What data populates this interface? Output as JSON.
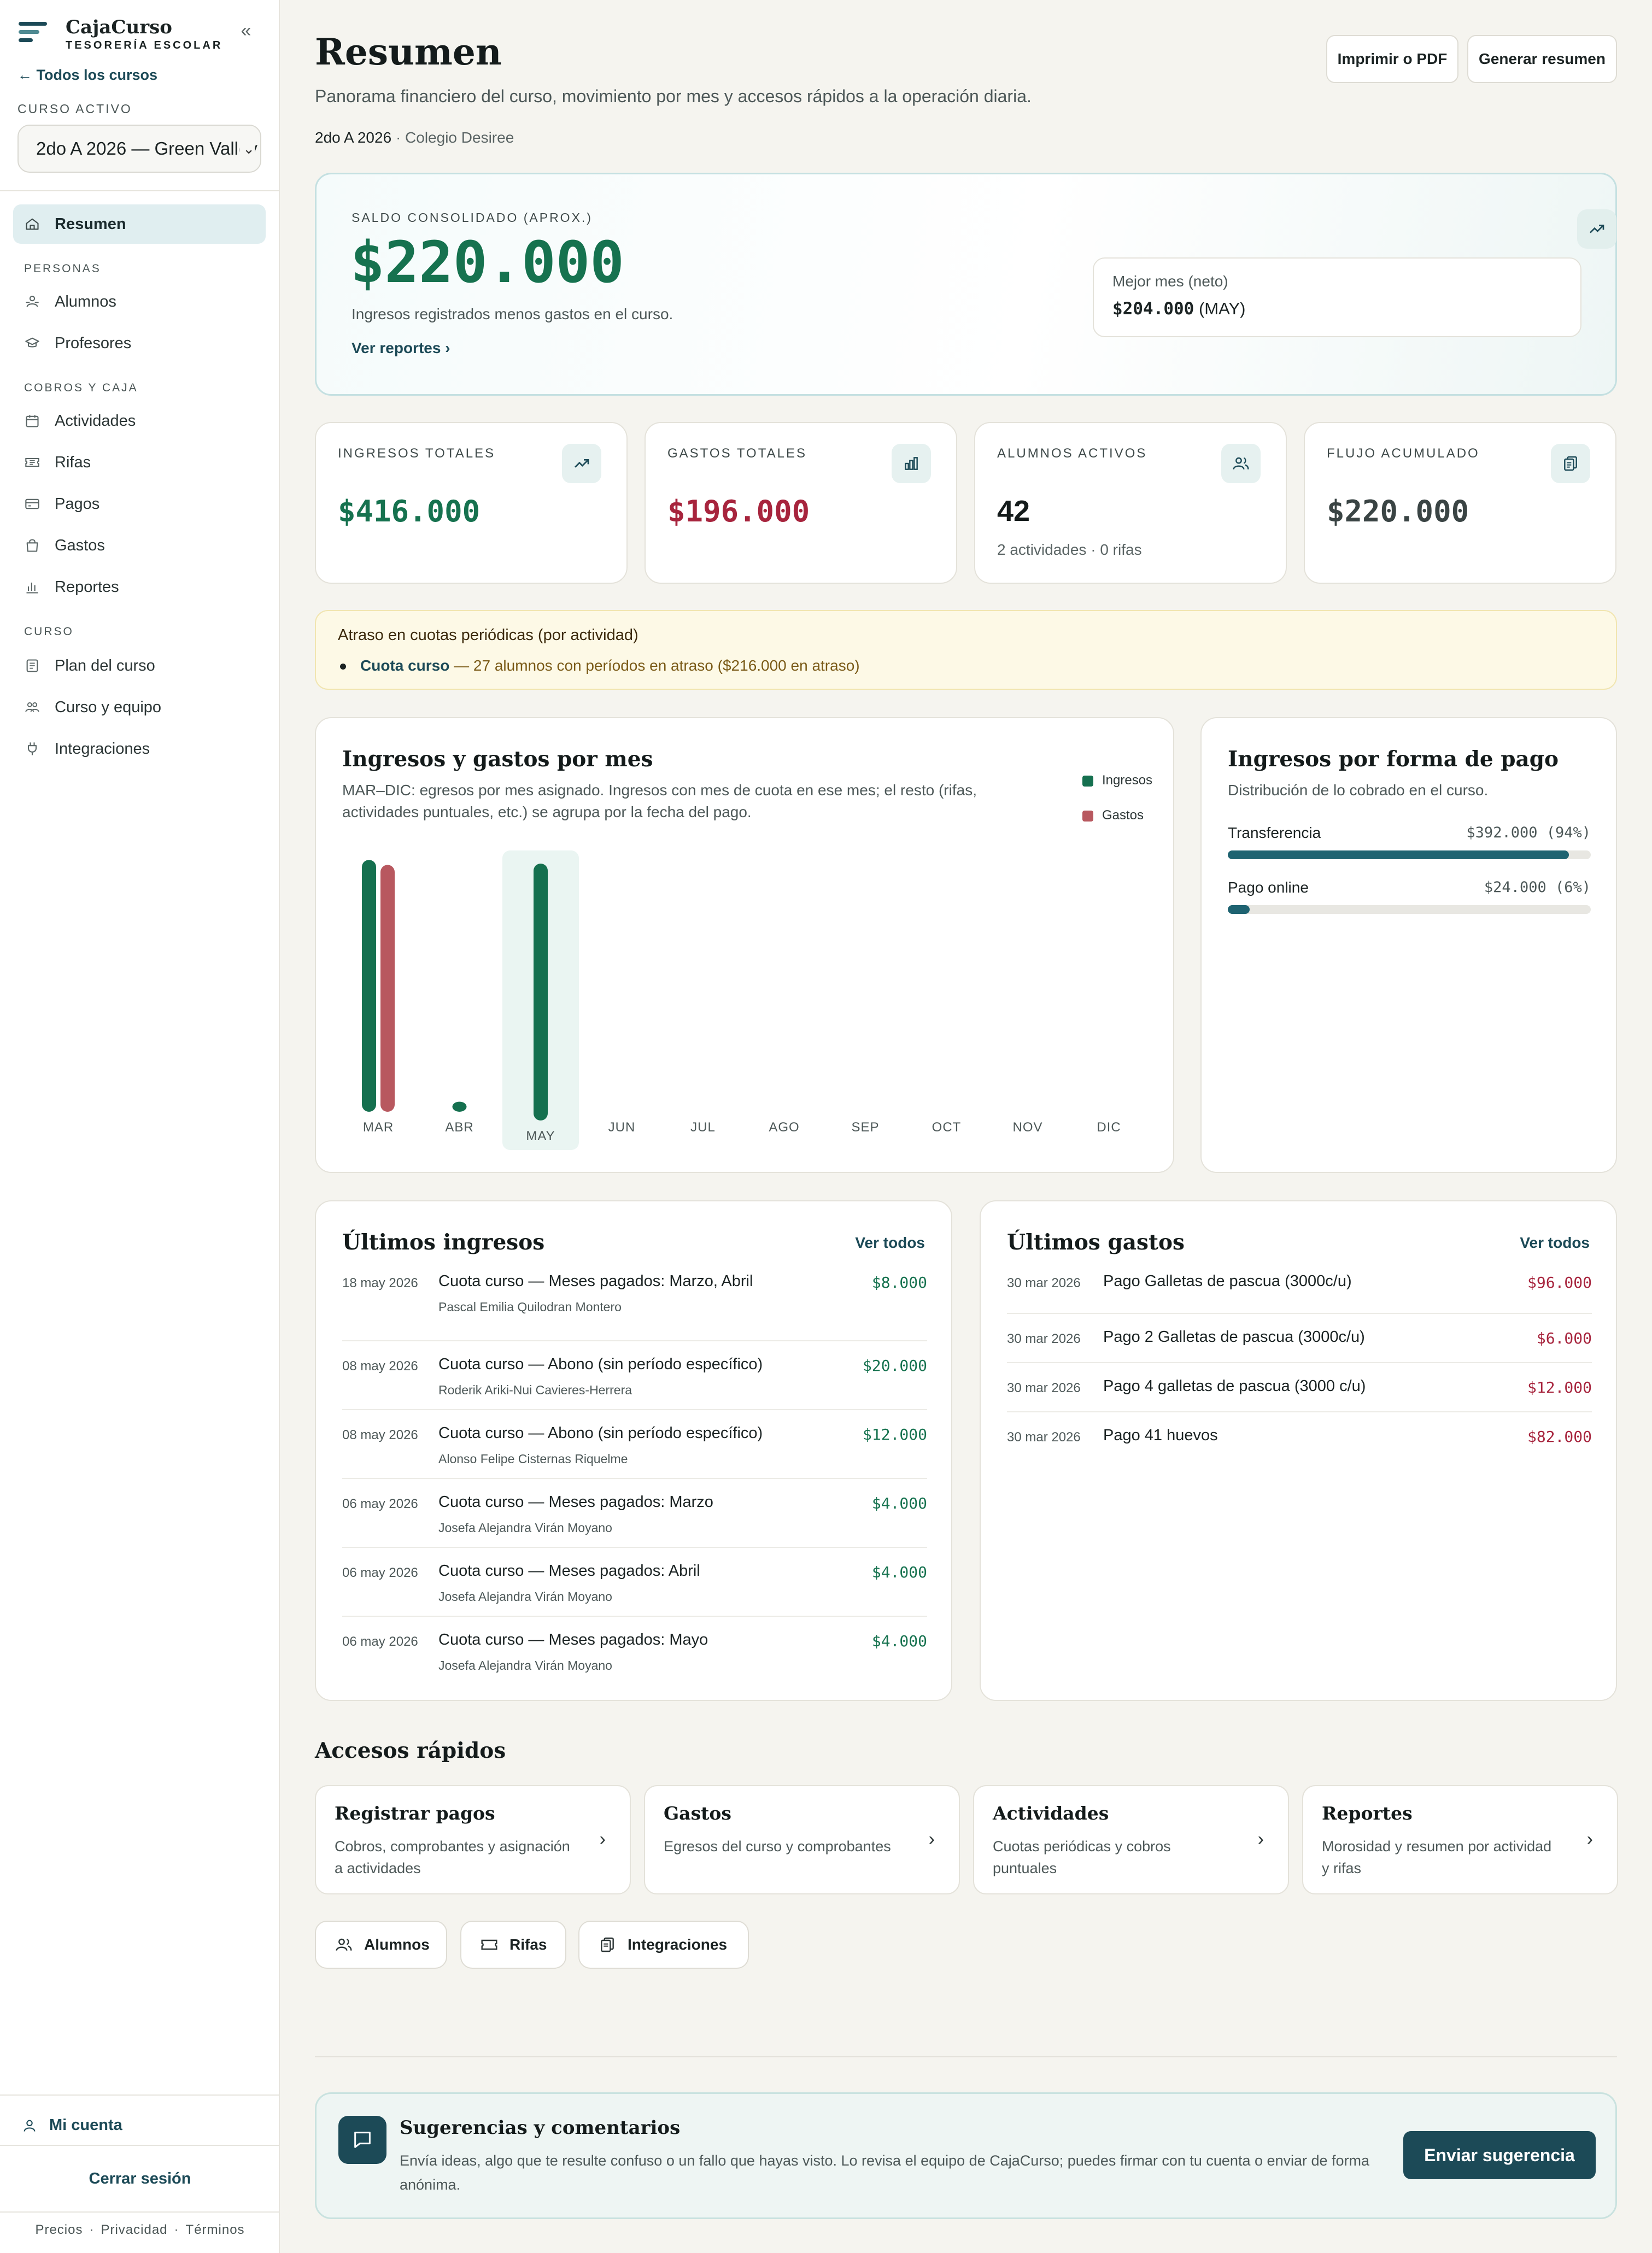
{
  "sidebar": {
    "brand_name": "CajaCurso",
    "brand_sub": "TESORERÍA ESCOLAR",
    "back_link": "← Todos los cursos",
    "course_label": "CURSO ACTIVO",
    "course_selected": "2do A 2026 — Green Valley",
    "nav_active": "Resumen",
    "sections": {
      "personas": "PERSONAS",
      "cobros": "COBROS Y CAJA",
      "curso": "CURSO"
    },
    "items": {
      "resumen": "Resumen",
      "alumnos": "Alumnos",
      "profesores": "Profesores",
      "actividades": "Actividades",
      "rifas": "Rifas",
      "pagos": "Pagos",
      "gastos": "Gastos",
      "reportes": "Reportes",
      "plan": "Plan del curso",
      "equipo": "Curso y equipo",
      "integraciones": "Integraciones"
    },
    "account": "Mi cuenta",
    "logout": "Cerrar sesión",
    "legal": [
      "Precios",
      "Privacidad",
      "Términos"
    ]
  },
  "header": {
    "title": "Resumen",
    "description": "Panorama financiero del curso, movimiento por mes y accesos rápidos a la operación diaria.",
    "course": "2do A 2026",
    "school": "Colegio Desiree",
    "print_button": "Imprimir o PDF",
    "summary_button": "Generar resumen"
  },
  "hero": {
    "label": "SALDO CONSOLIDADO (APROX.)",
    "amount": "$220.000",
    "subtitle": "Ingresos registrados menos gastos en el curso.",
    "link": "Ver reportes",
    "best_month_label": "Mejor mes (neto)",
    "best_month_value": "$204.000",
    "best_month_name": "(MAY)"
  },
  "stats": [
    {
      "label": "INGRESOS TOTALES",
      "value": "$416.000",
      "sub": "",
      "icon": "trend-up-icon"
    },
    {
      "label": "GASTOS TOTALES",
      "value": "$196.000",
      "sub": "",
      "icon": "bar-chart-icon"
    },
    {
      "label": "ALUMNOS ACTIVOS",
      "value": "42",
      "sub": "2 actividades · 0 rifas",
      "icon": "users-icon"
    },
    {
      "label": "FLUJO ACUMULADO",
      "value": "$220.000",
      "sub": "",
      "icon": "clipboard-icon"
    }
  ],
  "alert": {
    "title": "Atraso en cuotas periódicas (por actividad)",
    "item_name": "Cuota curso",
    "item_detail": " — 27 alumnos con períodos en atraso ($216.000 en atraso)"
  },
  "monthly_chart": {
    "title": "Ingresos y gastos por mes",
    "description": "MAR–DIC: egresos por mes asignado. Ingresos con mes de cuota en ese mes; el resto (rifas, actividades puntuales, etc.) se agrupa por la fecha del pago.",
    "selected_month": "MAY"
  },
  "chart_data": {
    "type": "bar",
    "categories": [
      "MAR",
      "ABR",
      "MAY",
      "JUN",
      "JUL",
      "AGO",
      "SEP",
      "OCT",
      "NOV",
      "DIC"
    ],
    "series": [
      {
        "name": "Ingresos",
        "color": "#15704f",
        "values": [
          200000,
          8000,
          204000,
          0,
          0,
          0,
          0,
          0,
          0,
          0
        ]
      },
      {
        "name": "Gastos",
        "color": "#b8585f",
        "values": [
          196000,
          0,
          0,
          0,
          0,
          0,
          0,
          0,
          0,
          0
        ]
      }
    ],
    "title": "Ingresos y gastos por mes",
    "legend_position": "top-right",
    "grid": false
  },
  "payment_methods": {
    "title": "Ingresos por forma de pago",
    "description": "Distribución de lo cobrado en el curso.",
    "rows": [
      {
        "name": "Transferencia",
        "value": "$392.000 (94%)",
        "fraction": 0.94
      },
      {
        "name": "Pago online",
        "value": "$24.000 (6%)",
        "fraction": 0.06
      }
    ]
  },
  "income_list": {
    "title": "Últimos ingresos",
    "more": "Ver todos",
    "rows": [
      {
        "date": "18 may 2026",
        "title": "Cuota curso — Meses pagados: Marzo, Abril",
        "sub": "Pascal Emilia Quilodran Montero",
        "amount": "$8.000"
      },
      {
        "date": "08 may 2026",
        "title": "Cuota curso — Abono (sin período específico)",
        "sub": "Roderik Ariki-Nui Cavieres-Herrera",
        "amount": "$20.000"
      },
      {
        "date": "08 may 2026",
        "title": "Cuota curso — Abono (sin período específico)",
        "sub": "Alonso Felipe Cisternas Riquelme",
        "amount": "$12.000"
      },
      {
        "date": "06 may 2026",
        "title": "Cuota curso — Meses pagados: Marzo",
        "sub": "Josefa Alejandra Virán Moyano",
        "amount": "$4.000"
      },
      {
        "date": "06 may 2026",
        "title": "Cuota curso — Meses pagados: Abril",
        "sub": "Josefa Alejandra Virán Moyano",
        "amount": "$4.000"
      },
      {
        "date": "06 may 2026",
        "title": "Cuota curso — Meses pagados: Mayo",
        "sub": "Josefa Alejandra Virán Moyano",
        "amount": "$4.000"
      }
    ]
  },
  "expense_list": {
    "title": "Últimos gastos",
    "more": "Ver todos",
    "rows": [
      {
        "date": "30 mar 2026",
        "title": "Pago Galletas de pascua (3000c/u)",
        "amount": "$96.000"
      },
      {
        "date": "30 mar 2026",
        "title": "Pago 2 Galletas de pascua (3000c/u)",
        "amount": "$6.000"
      },
      {
        "date": "30 mar 2026",
        "title": "Pago 4 galletas de pascua (3000 c/u)",
        "amount": "$12.000"
      },
      {
        "date": "30 mar 2026",
        "title": "Pago 41 huevos",
        "amount": "$82.000"
      }
    ]
  },
  "quick_access": {
    "title": "Accesos rápidos",
    "cards": [
      {
        "title": "Registrar pagos",
        "desc": "Cobros, comprobantes y asignación a actividades"
      },
      {
        "title": "Gastos",
        "desc": "Egresos del curso y comprobantes"
      },
      {
        "title": "Actividades",
        "desc": "Cuotas periódicas y cobros puntuales"
      },
      {
        "title": "Reportes",
        "desc": "Morosidad y resumen por actividad y rifas"
      }
    ],
    "chips": [
      "Alumnos",
      "Rifas",
      "Integraciones"
    ]
  },
  "feedback": {
    "title": "Sugerencias y comentarios",
    "description": "Envía ideas, algo que te resulte confuso o un fallo que hayas visto. Lo revisa el equipo de CajaCurso; puedes firmar con tu cuenta o enviar de forma anónima.",
    "button": "Enviar sugerencia"
  },
  "colors": {
    "accent": "#1c4a57",
    "income": "#16724f",
    "expense": "#a7243d",
    "active_nav": "#e0eef0"
  }
}
